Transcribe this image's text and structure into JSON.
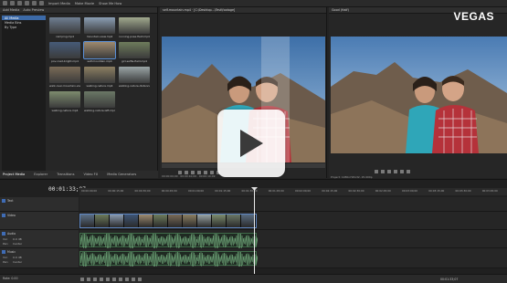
{
  "app": {
    "watermark": "VEGAS"
  },
  "toolbar": {
    "import_media_label": "Import Media",
    "make_movie_label": "Make Movie",
    "show_me_how_label": "Show Me How"
  },
  "explorer": {
    "add_media_label": "Add Media",
    "auto_preview_label": "Auto Preview",
    "tree": [
      "All Media",
      "Media Bins",
      "By Type"
    ],
    "thumbs": [
      {
        "caption": "camping.mp4",
        "color": "#6f7f93"
      },
      {
        "caption": "mountain-view.mp4",
        "color": "#8b9fb4"
      },
      {
        "caption": "running-pose-field.mp4",
        "color": "#a1a98e"
      },
      {
        "caption": "pov-road-bright.mp4",
        "color": "#465b78"
      },
      {
        "caption": "self-mountain.mp4",
        "color": "#9e8a6f"
      },
      {
        "caption": "girl-selfie-field.mp4",
        "color": "#6e7c5c"
      },
      {
        "caption": "walk-over-mountain-view.mp4",
        "color": "#7a6b57"
      },
      {
        "caption": "walking-nature.mp4",
        "color": "#8c7f62"
      },
      {
        "caption": "walking-nature-distance.mp4",
        "color": "#9aa5a6"
      },
      {
        "caption": "walking-nature.mp4",
        "color": "#7d8c6e"
      },
      {
        "caption": "walking-nature-left.mp4",
        "color": "#6b7866"
      }
    ],
    "status": "Video: 1280x720x32, 25.000 fps, 00:00:08:03, Alpha = None, Field Order = None"
  },
  "panel_tabs": {
    "project_media": "Project Media",
    "explorer": "Explorer",
    "transitions": "Transitions",
    "video_fx": "Video FX",
    "media_generators": "Media Generators"
  },
  "trimmer": {
    "title": "self-mountain.mp4 · [C:\\Desktop...\\Test\\footage]",
    "footer_time": "00:00:00;00 · 00:00:10;09 · 00:00:10;09"
  },
  "preview": {
    "title": "Good (Half)",
    "info": [
      "Project: 1280x720x32, 25.000p",
      "Preview: 1280x720x32, 25.000p",
      "Display: 384x216x32"
    ],
    "info_right": [
      "Frame: 225",
      "Display: 384x216x32"
    ]
  },
  "timeline": {
    "timecode": "00:01:33;07",
    "ruler_labels": [
      "00:00:00;00",
      "00:00:15;00",
      "00:00:30;00",
      "00:00:45;00",
      "00:01:00;00",
      "00:01:15;00",
      "00:01:30;00",
      "00:01:45;00",
      "00:02:00;00",
      "00:02:15;00",
      "00:02:30;00",
      "00:02:45;00",
      "00:03:00;00",
      "00:03:15;00",
      "00:03:30;00",
      "00:03:45;00"
    ],
    "tracks": [
      {
        "name": "Text"
      },
      {
        "name": "Video"
      },
      {
        "name": "Audio",
        "vol": "Vol:",
        "vol_val": "0.0 dB",
        "pan": "Pan:",
        "pan_val": "Center"
      },
      {
        "name": "Music",
        "vol": "Vol:",
        "vol_val": "0.0 dB",
        "pan": "Pan:",
        "pan_val": "Center"
      }
    ],
    "rate": "Rate: 0.00",
    "bottom_time": "00:01:33;07",
    "bottom_info": "Record Time"
  }
}
